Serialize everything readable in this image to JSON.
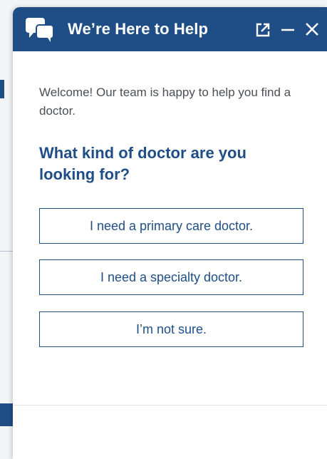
{
  "header": {
    "title": "We’re Here to Help",
    "icons": [
      "chat-bubbles-icon",
      "popout-icon",
      "minimize-icon",
      "close-icon"
    ]
  },
  "main": {
    "welcome": "Welcome! Our team is happy to help you find a doctor.",
    "question": "What kind of doctor are you looking for?",
    "options": [
      {
        "label": "I need a primary care doctor."
      },
      {
        "label": "I need a specialty doctor."
      },
      {
        "label": "I’m not sure."
      }
    ]
  },
  "colors": {
    "brand": "#1f4e87",
    "text": "#4a4f55",
    "background": "#ffffff"
  }
}
